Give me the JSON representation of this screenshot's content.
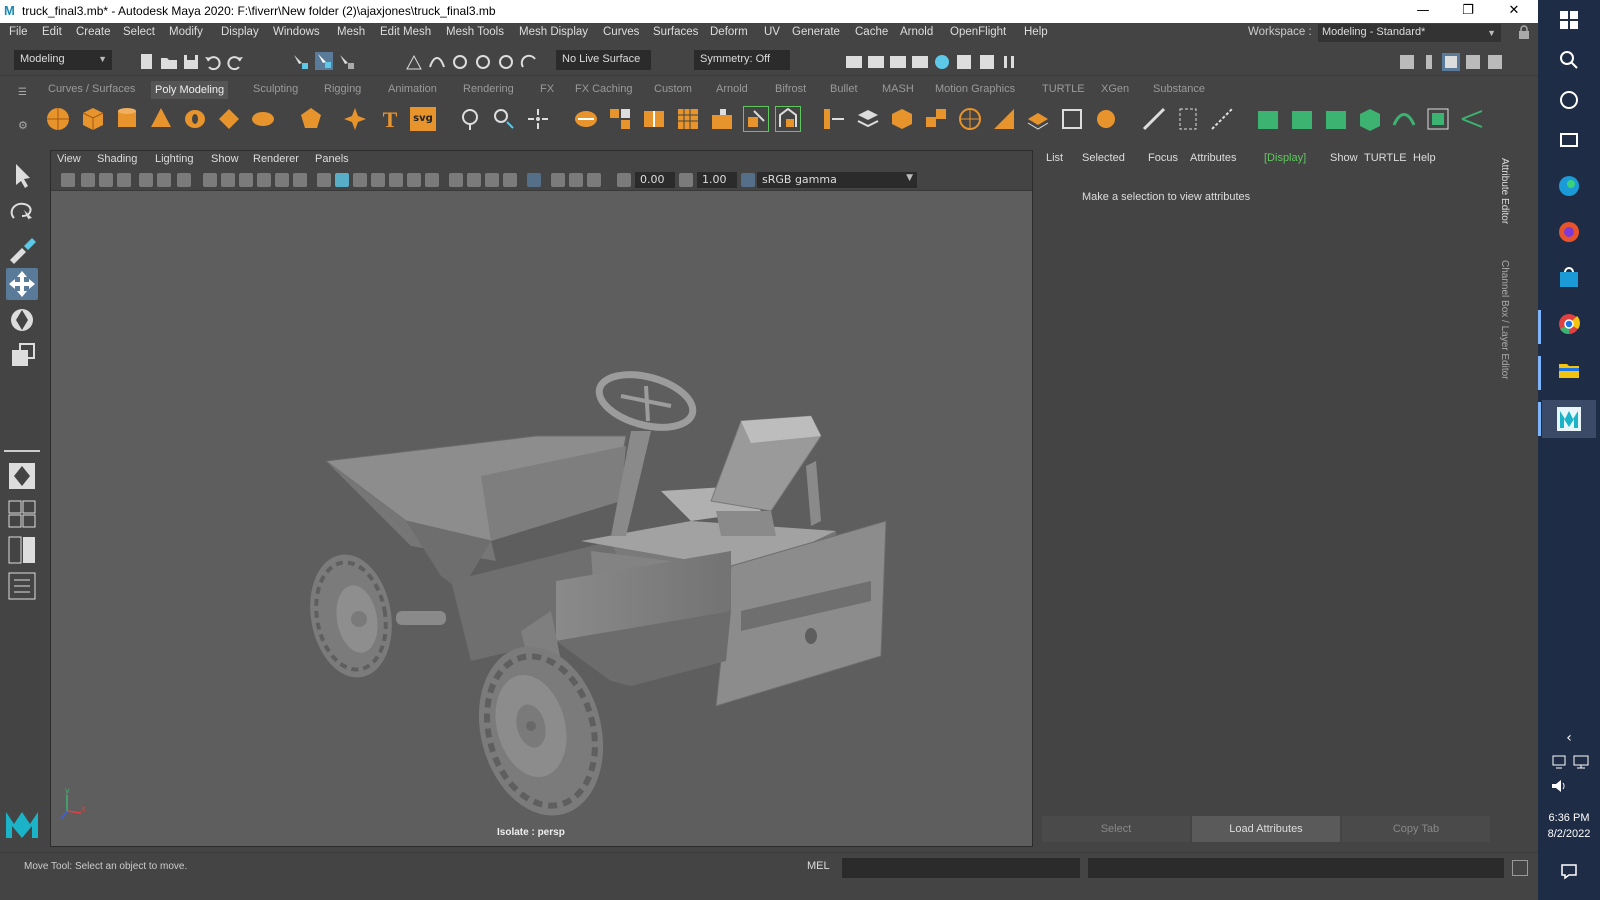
{
  "window": {
    "title": "truck_final3.mb* - Autodesk Maya 2020: F:\\fiverr\\New folder (2)\\ajaxjones\\truck_final3.mb",
    "logo": "M",
    "minimize": "—",
    "restore": "❐",
    "close": "✕"
  },
  "menu": [
    "File",
    "Edit",
    "Create",
    "Select",
    "Modify",
    "Display",
    "Windows",
    "Mesh",
    "Edit Mesh",
    "Mesh Tools",
    "Mesh Display",
    "Curves",
    "Surfaces",
    "Deform",
    "UV",
    "Generate",
    "Cache",
    "Arnold",
    "OpenFlight",
    "Help"
  ],
  "workspace": {
    "label": "Workspace :",
    "value": "Modeling - Standard*"
  },
  "status_line": {
    "menuset": "Modeling",
    "live_surface": "No Live Surface",
    "symmetry": "Symmetry: Off"
  },
  "shelf_tabs": [
    "Curves / Surfaces",
    "Poly Modeling",
    "Sculpting",
    "Rigging",
    "Animation",
    "Rendering",
    "FX",
    "FX Caching",
    "Custom",
    "Arnold",
    "Bifrost",
    "Bullet",
    "MASH",
    "Motion Graphics",
    "TURTLE",
    "XGen",
    "Substance"
  ],
  "shelf_active": "Poly Modeling",
  "shelf_icons": [
    "sphere-icon",
    "cube-icon",
    "cylinder-icon",
    "cone-icon",
    "torus-icon",
    "plane-icon",
    "disc-icon",
    "platonic-icon",
    "super-shape-icon",
    "type-icon",
    "svg-icon",
    "sphere-mesh-icon",
    "combine-icon",
    "separate-icon",
    "extract-icon",
    "mirror-icon",
    "bevel-icon",
    "extrude-icon",
    "bridge-icon",
    "fill-hole-icon",
    "multi-cut-icon",
    "insert-edge-loop-icon",
    "offset-edge-loop-icon",
    "target-weld-icon",
    "quad-draw-icon",
    "smooth-icon",
    "reduce-icon"
  ],
  "shelf_svg": "svg",
  "shelf_type": "T",
  "viewport": {
    "menu": [
      "View",
      "Shading",
      "Lighting",
      "Show",
      "Renderer",
      "Panels"
    ],
    "exposure": "0.00",
    "gamma": "1.00",
    "colorspace": "sRGB gamma",
    "label": "Isolate : persp",
    "axis_y": "y",
    "axis_x": "x"
  },
  "attribute_editor": {
    "menu": [
      "List",
      "Selected",
      "Focus",
      "Attributes",
      "[Display]",
      "Show",
      "TURTLE",
      "Help"
    ],
    "message": "Make a selection to view attributes",
    "buttons": [
      "Select",
      "Load Attributes",
      "Copy Tab"
    ],
    "side_tab_1": "Attribute Editor",
    "side_tab_2": "Channel Box / Layer Editor"
  },
  "help_line": {
    "message": "Move Tool: Select an object to move.",
    "mel": "MEL"
  },
  "taskbar": {
    "time": "6:36 PM",
    "date": "8/2/2022"
  },
  "colors": {
    "accent": "#5ec8e8",
    "active_display": "#5ec85e"
  }
}
